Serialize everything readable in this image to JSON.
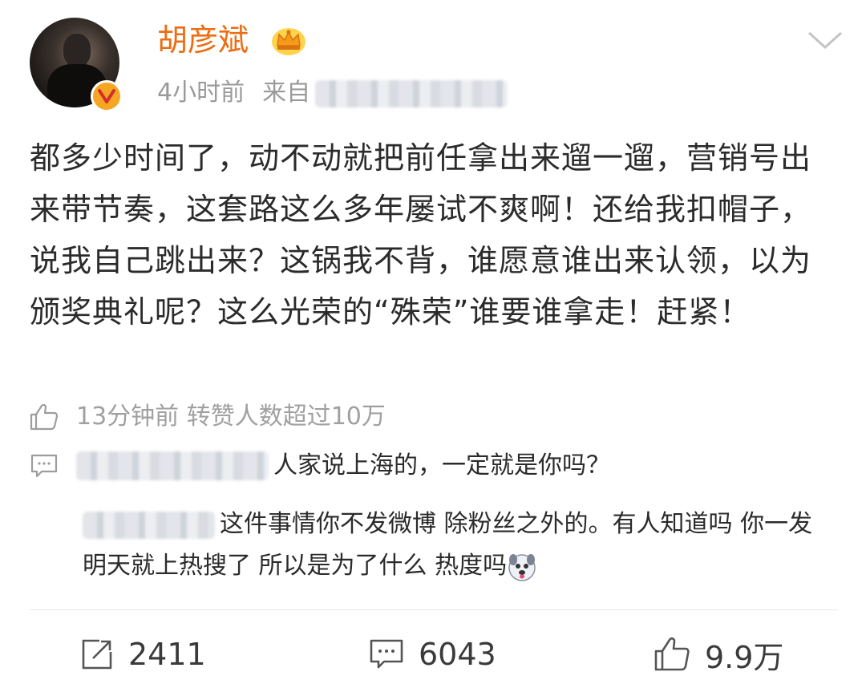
{
  "post": {
    "username": "胡彦斌",
    "time": "4小时前",
    "source_prefix": "来自",
    "content": "都多少时间了，动不动就把前任拿出来遛一遛，营销号出来带节奏，这套路这么多年屡试不爽啊！还给我扣帽子，说我自己跳出来？这锅我不背，谁愿意谁出来认领，以为颁奖典礼呢？这么光荣的“殊荣”谁要谁拿走！赶紧！"
  },
  "extras": {
    "like_note": "13分钟前 转赞人数超过10万",
    "comment1": "人家说上海的，一定就是你吗？",
    "comment2": "这件事情你不发微博 除粉丝之外的。有人知道吗 你一发明天就上热搜了 所以是为了什么 热度吗"
  },
  "actions": {
    "reposts": "2411",
    "comments": "6043",
    "likes": "9.9万"
  },
  "icons": {
    "verified": "verified-v-icon",
    "crown": "crown-vip-icon",
    "menu": "chevron-down-icon",
    "like": "thumbs-up-icon",
    "comment": "comment-icon",
    "repost": "repost-icon",
    "emoji": "dog-face-emoji-icon"
  },
  "colors": {
    "username": "#ec6d12",
    "meta": "#9a9a9a",
    "text": "#2b2b2b",
    "badge": "#f5a623"
  }
}
